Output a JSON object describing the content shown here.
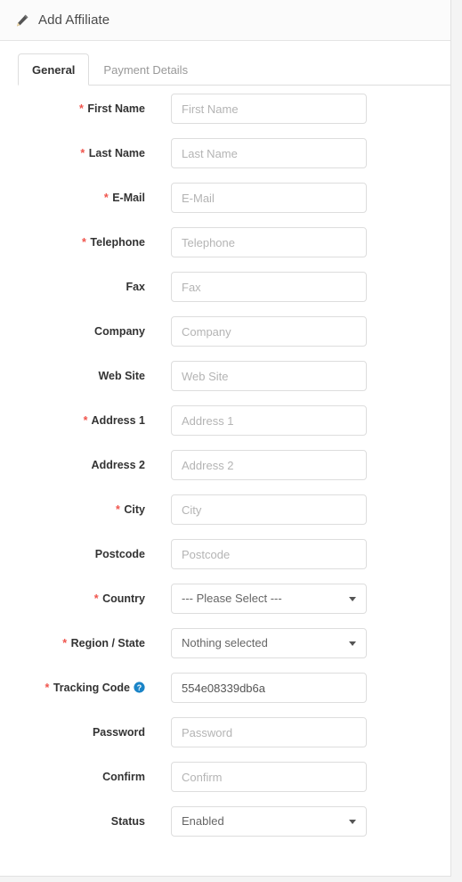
{
  "header": {
    "icon": "pencil-icon",
    "title": "Add Affiliate"
  },
  "tabs": [
    {
      "label": "General",
      "active": true
    },
    {
      "label": "Payment Details",
      "active": false
    }
  ],
  "colors": {
    "required_asterisk": "#f0544c",
    "help_icon": "#1a84c7",
    "border": "#dddddd",
    "label_text": "#333333",
    "placeholder": "#b4b4b4"
  },
  "form": {
    "fields": [
      {
        "name": "first-name",
        "label": "First Name",
        "required": true,
        "type": "text",
        "placeholder": "First Name",
        "value": ""
      },
      {
        "name": "last-name",
        "label": "Last Name",
        "required": true,
        "type": "text",
        "placeholder": "Last Name",
        "value": ""
      },
      {
        "name": "email",
        "label": "E-Mail",
        "required": true,
        "type": "text",
        "placeholder": "E-Mail",
        "value": ""
      },
      {
        "name": "telephone",
        "label": "Telephone",
        "required": true,
        "type": "text",
        "placeholder": "Telephone",
        "value": ""
      },
      {
        "name": "fax",
        "label": "Fax",
        "required": false,
        "type": "text",
        "placeholder": "Fax",
        "value": ""
      },
      {
        "name": "company",
        "label": "Company",
        "required": false,
        "type": "text",
        "placeholder": "Company",
        "value": ""
      },
      {
        "name": "web-site",
        "label": "Web Site",
        "required": false,
        "type": "text",
        "placeholder": "Web Site",
        "value": ""
      },
      {
        "name": "address-1",
        "label": "Address 1",
        "required": true,
        "type": "text",
        "placeholder": "Address 1",
        "value": ""
      },
      {
        "name": "address-2",
        "label": "Address 2",
        "required": false,
        "type": "text",
        "placeholder": "Address 2",
        "value": ""
      },
      {
        "name": "city",
        "label": "City",
        "required": true,
        "type": "text",
        "placeholder": "City",
        "value": ""
      },
      {
        "name": "postcode",
        "label": "Postcode",
        "required": false,
        "type": "text",
        "placeholder": "Postcode",
        "value": ""
      },
      {
        "name": "country",
        "label": "Country",
        "required": true,
        "type": "select",
        "value": "--- Please Select ---"
      },
      {
        "name": "region-state",
        "label": "Region / State",
        "required": true,
        "type": "select",
        "value": "Nothing selected"
      },
      {
        "name": "tracking-code",
        "label": "Tracking Code",
        "required": true,
        "type": "text",
        "placeholder": "Tracking Code",
        "value": "554e08339db6a",
        "help": true
      },
      {
        "name": "password",
        "label": "Password",
        "required": false,
        "type": "password",
        "placeholder": "Password",
        "value": ""
      },
      {
        "name": "confirm",
        "label": "Confirm",
        "required": false,
        "type": "password",
        "placeholder": "Confirm",
        "value": ""
      },
      {
        "name": "status",
        "label": "Status",
        "required": false,
        "type": "select",
        "value": "Enabled"
      }
    ]
  }
}
